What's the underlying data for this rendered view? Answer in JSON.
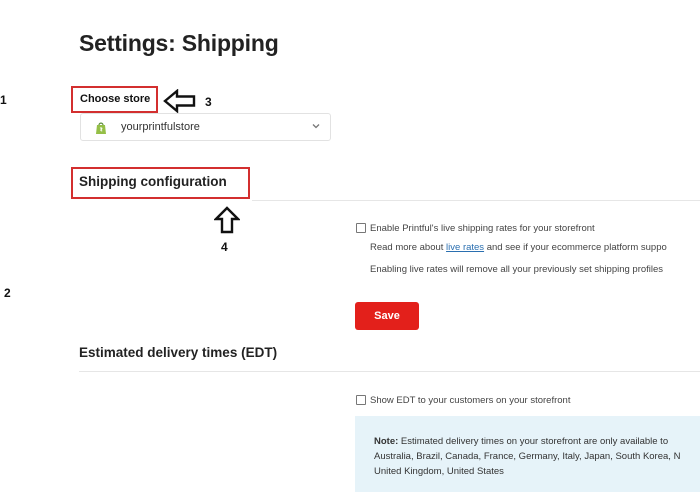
{
  "page": {
    "title": "Settings: Shipping"
  },
  "annotations": {
    "n1": "1",
    "n2": "2",
    "n3": "3",
    "n4": "4"
  },
  "store": {
    "label": "Choose store",
    "selected": "yourprintfulstore",
    "icon": "shopify-bag-icon"
  },
  "shipping": {
    "title": "Shipping configuration",
    "live_rates_label": "Enable Printful's live shipping rates for your storefront",
    "read_more_prefix": "Read more about ",
    "read_more_link": "live rates",
    "read_more_suffix": " and see if your ecommerce platform suppo",
    "warning": "Enabling live rates will remove all your previously set shipping profiles",
    "save_label": "Save"
  },
  "edt": {
    "title": "Estimated delivery times (EDT)",
    "checkbox_label": "Show EDT to your customers on your storefront",
    "note_label": "Note:",
    "note_line1": " Estimated delivery times on your storefront are only available to",
    "note_line2": "Australia, Brazil, Canada, France, Germany, Italy, Japan, South Korea, N",
    "note_line3": "United Kingdom, United States"
  },
  "colors": {
    "accent_red": "#e3201b",
    "annotation_red": "#d32f2f",
    "link_blue": "#2a6fb0",
    "note_bg": "#e6f3f9",
    "shopify_green": "#95bf47"
  }
}
